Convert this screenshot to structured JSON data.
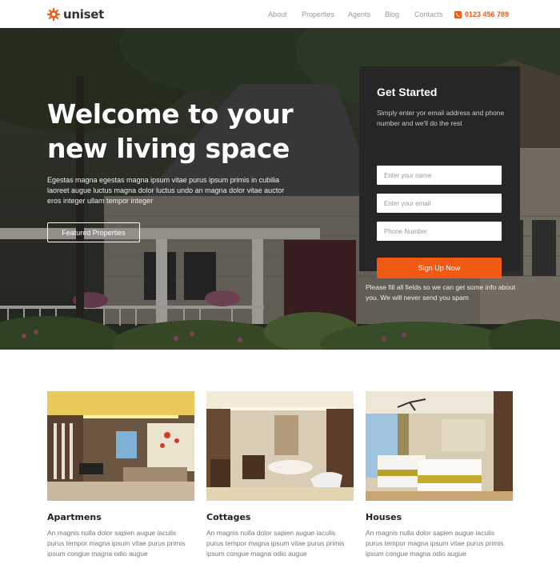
{
  "brand": {
    "name": "uniset",
    "logo_icon": "sun-gear-icon",
    "accent": "#f05a14"
  },
  "nav": {
    "links": [
      "About",
      "Properties",
      "Agents",
      "Blog",
      "Contacts"
    ],
    "phone": "0123 456 789",
    "phone_icon": "phone-icon"
  },
  "hero": {
    "title": "Welcome to your new living space",
    "text": "Egestas magna egestas magna ipsum vitae purus ipsum primis in cubilia laoreet augue luctus magna dolor luctus undo an magna dolor vitae auctor eros integer ullam tempor integer",
    "button": "Featured Properties"
  },
  "signup": {
    "title": "Get Started",
    "description": "Simply enter yor email address and phone number and we'll do the rest",
    "name_placeholder": "Enter your name",
    "email_placeholder": "Enter your email",
    "phone_placeholder": "Phone Number",
    "button": "Sign Up Now",
    "note": "Please fill all fields so we can get some info about you. We will never send you spam"
  },
  "cards": [
    {
      "title": "Apartmens",
      "text": "An magnis nulla dolor sapien augue iaculis purus tempor magna ipsum vitae purus primis ipsum congue magna odio augue"
    },
    {
      "title": "Cottages",
      "text": "An magnis nulla dolor sapien augue iaculis purus tempor magna ipsum vitae purus primis ipsum congue magna odio augue"
    },
    {
      "title": "Houses",
      "text": "An magnis nulla dolor sapien augue iaculis purus tempor magna ipsum vitae purus primis ipsum congue magna odio augue"
    }
  ]
}
